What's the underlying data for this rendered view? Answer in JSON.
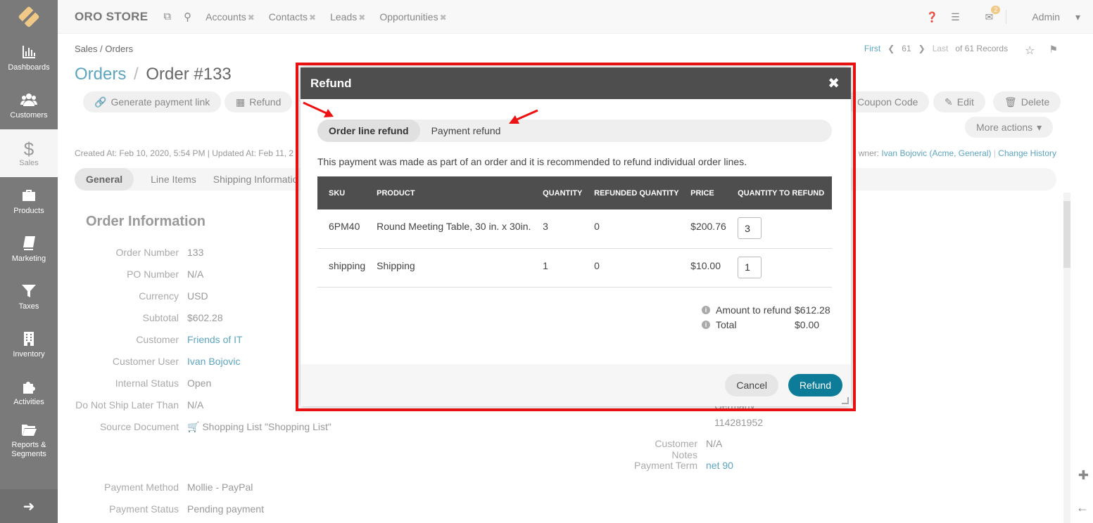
{
  "sidebar": {
    "items": [
      {
        "label": "Dashboards",
        "icon": "bar-chart-icon"
      },
      {
        "label": "Customers",
        "icon": "users-icon"
      },
      {
        "label": "Sales",
        "icon": "dollar-icon"
      },
      {
        "label": "Products",
        "icon": "briefcase-icon"
      },
      {
        "label": "Marketing",
        "icon": "book-icon"
      },
      {
        "label": "Taxes",
        "icon": "filter-icon"
      },
      {
        "label": "Inventory",
        "icon": "building-icon"
      },
      {
        "label": "Activities",
        "icon": "puzzle-icon"
      },
      {
        "label": "Reports & Segments",
        "icon": "folder-icon"
      }
    ]
  },
  "header": {
    "brand": "ORO STORE",
    "tabs": [
      "Accounts",
      "Contacts",
      "Leads",
      "Opportunities"
    ],
    "user": "Admin",
    "notification_count": "2"
  },
  "breadcrumb": "Sales / Orders",
  "pager": {
    "first": "First",
    "current": "61",
    "last": "Last",
    "total": "of 61 Records"
  },
  "title": {
    "section": "Orders",
    "sep": "/",
    "entity": "Order #133"
  },
  "actions": {
    "generate_link": "Generate payment link",
    "refund": "Refund",
    "coupon": "Coupon Code",
    "edit": "Edit",
    "delete": "Delete",
    "more": "More actions"
  },
  "meta": {
    "left": "Created At: Feb 10, 2020, 5:54 PM  |  Updated At: Feb 11, 2",
    "owner_prefix": "wner:",
    "owner": "Ivan Bojovic (Acme, General)",
    "history": "Change History"
  },
  "sections": [
    "General",
    "Line Items",
    "Shipping Informatio"
  ],
  "order_info": {
    "heading": "Order Information",
    "fields": [
      {
        "k": "Order Number",
        "v": "133"
      },
      {
        "k": "PO Number",
        "v": "N/A"
      },
      {
        "k": "Currency",
        "v": "USD"
      },
      {
        "k": "Subtotal",
        "v": "$602.28"
      },
      {
        "k": "Customer",
        "v": "Friends of IT"
      },
      {
        "k": "Customer User",
        "v": "Ivan Bojovic"
      },
      {
        "k": "Internal Status",
        "v": "Open"
      },
      {
        "k": "Do Not Ship Later Than",
        "v": "N/A"
      },
      {
        "k": "Source Document",
        "v": "Shopping List \"Shopping List\""
      },
      {
        "k": "Payment Method",
        "v": "Mollie - PayPal"
      },
      {
        "k": "Payment Status",
        "v": "Pending payment"
      }
    ],
    "right_fields": [
      {
        "k": "Customer Notes",
        "v": "N/A"
      },
      {
        "k": "Payment Term",
        "v": "net 90"
      }
    ],
    "address_partial": "Germany",
    "phone": "114281952"
  },
  "modal": {
    "title": "Refund",
    "tabs": [
      "Order line refund",
      "Payment refund"
    ],
    "message": "This payment was made as part of an order and it is recommended to refund individual order lines.",
    "columns": [
      "SKU",
      "PRODUCT",
      "QUANTITY",
      "REFUNDED QUANTITY",
      "PRICE",
      "QUANTITY TO REFUND"
    ],
    "rows": [
      {
        "sku": "6PM40",
        "product": "Round Meeting Table, 30 in. x 30in.",
        "quantity": "3",
        "refunded": "0",
        "price": "$200.76",
        "to_refund": "3"
      },
      {
        "sku": "shipping",
        "product": "Shipping",
        "quantity": "1",
        "refunded": "0",
        "price": "$10.00",
        "to_refund": "1"
      }
    ],
    "amount_label": "Amount to refund",
    "amount_value": "$612.28",
    "total_label": "Total",
    "total_value": "$0.00",
    "cancel": "Cancel",
    "refund": "Refund"
  },
  "colors": {
    "accent": "#0c7c99",
    "link": "#5da5c0",
    "highlight": "#ee1111"
  }
}
